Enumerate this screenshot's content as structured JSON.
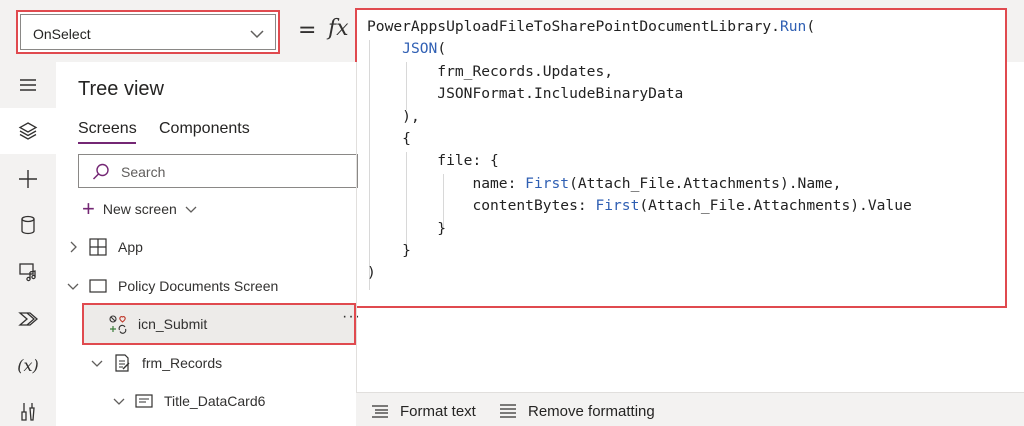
{
  "formula_bar": {
    "property": "OnSelect",
    "equals": "=",
    "fx": "fx",
    "code_lines": [
      [
        "",
        "PowerAppsUploadFileToSharePointDocumentLibrary.",
        "Run",
        "("
      ],
      [
        "    ",
        "",
        "JSON",
        "("
      ],
      [
        "        ",
        "frm_Records.Updates,",
        "",
        ""
      ],
      [
        "        ",
        "JSONFormat.IncludeBinaryData",
        "",
        ""
      ],
      [
        "    ",
        "),",
        "",
        ""
      ],
      [
        "    ",
        "{",
        "",
        ""
      ],
      [
        "        ",
        "file: {",
        "",
        ""
      ],
      [
        "            ",
        "name: ",
        "First",
        "(Attach_File.Attachments).Name,"
      ],
      [
        "            ",
        "contentBytes: ",
        "First",
        "(Attach_File.Attachments).Value"
      ],
      [
        "        ",
        "}",
        "",
        ""
      ],
      [
        "    ",
        "}",
        "",
        ""
      ],
      [
        "",
        ")",
        "",
        ""
      ]
    ]
  },
  "rail": {
    "icons": [
      "hamburger-icon",
      "layers-icon",
      "plus-icon",
      "data-icon",
      "media-icon",
      "power-automate-icon",
      "variables-icon",
      "tools-icon"
    ],
    "variables_label": "(x)"
  },
  "tree_view": {
    "title": "Tree view",
    "tabs": [
      "Screens",
      "Components"
    ],
    "search_placeholder": "Search",
    "new_screen": "New screen",
    "items": {
      "app": "App",
      "screen": "Policy Documents Screen",
      "icon_item": "icn_Submit",
      "more": "···",
      "form": "frm_Records",
      "datacard": "Title_DataCard6"
    }
  },
  "bottom_toolbar": {
    "format_text": "Format text",
    "remove_formatting": "Remove formatting"
  },
  "colors": {
    "highlight": "#e04a4f",
    "accent": "#742774",
    "keyword": "#2f5fb3"
  }
}
